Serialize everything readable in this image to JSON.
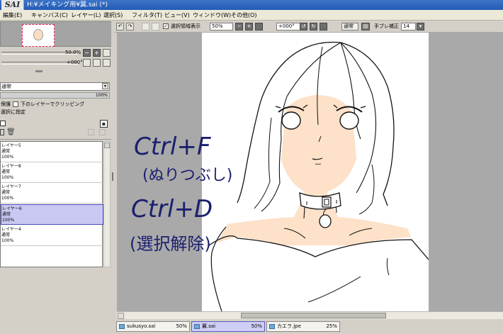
{
  "app": {
    "logo": "SAI",
    "title": "H:¥メイキング用¥翼.sai (*)"
  },
  "menu": [
    "編集(E)",
    "キャンバス(C)",
    "レイヤー(L)",
    "選択(S)",
    "フィルタ(T)",
    "ビュー(V)",
    "ウィンドウ(W)",
    "その他(O)"
  ],
  "navigator": {
    "zoom": "50.0%",
    "rotation": "+000°"
  },
  "layer_props": {
    "blend_mode": "通常",
    "opacity": "100%",
    "protect_label": "保護",
    "clipping_label": "下のレイヤーでクリッピング",
    "specify_label": "選択に指定"
  },
  "layers": [
    {
      "name": "レイヤー5",
      "mode": "通常",
      "opacity": "100%",
      "selected": false
    },
    {
      "name": "レイヤー8",
      "mode": "通常",
      "opacity": "100%",
      "selected": false
    },
    {
      "name": "レイヤー7",
      "mode": "通常",
      "opacity": "100%",
      "selected": false
    },
    {
      "name": "レイヤー6",
      "mode": "通常",
      "opacity": "100%",
      "selected": true
    },
    {
      "name": "レイヤー4",
      "mode": "通常",
      "opacity": "100%",
      "selected": false
    }
  ],
  "toolbar": {
    "selection_display_label": "選択領域表示",
    "zoom": "50%",
    "rotation": "+000°",
    "blend": "通常",
    "stabilizer_label": "手ブレ補正",
    "stabilizer_value": "14"
  },
  "canvas": {
    "note_line1": "Ctrl+F",
    "note_line2": "(ぬりつぶし)",
    "note_line3": "Ctrl+D",
    "note_line4": "(選択解除)",
    "skin_color": "#fde1c8",
    "ink_color": "#1b1f6e"
  },
  "tabs": [
    {
      "file": "sukusyo.sai",
      "zoom": "50%",
      "active": false
    },
    {
      "file": "翼.sai",
      "zoom": "50%",
      "active": true
    },
    {
      "file": "カエラ.jpe",
      "zoom": "25%",
      "active": false
    }
  ]
}
